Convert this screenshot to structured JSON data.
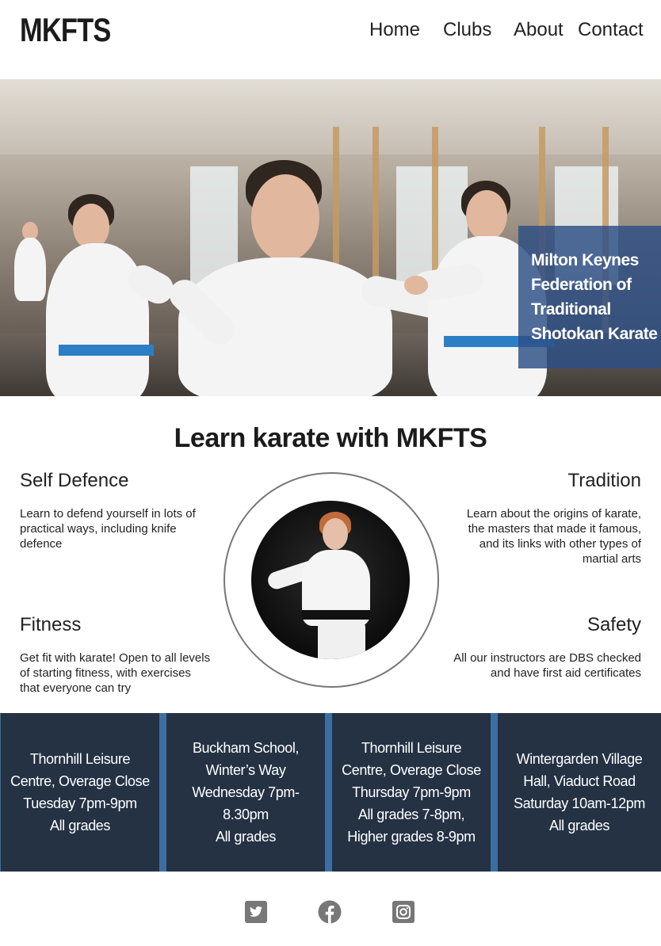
{
  "header": {
    "logo": "MKFTS",
    "nav": [
      {
        "label": "Home"
      },
      {
        "label": "Clubs"
      },
      {
        "label": "About"
      },
      {
        "label": "Contact"
      }
    ]
  },
  "hero": {
    "title": "Milton Keynes Federation of Traditional Shotokan Karate",
    "overlay_color": "#2c4e85"
  },
  "intro": {
    "title": "Learn karate with MKFTS",
    "features": [
      {
        "title": "Self Defence",
        "text": "Learn to defend yourself in lots of practical ways, including knife defence"
      },
      {
        "title": "Tradition",
        "text": "Learn about the origins of karate, the masters that made it famous, and its links with other types of martial arts"
      },
      {
        "title": "Fitness",
        "text": "Get fit with karate! Open to all levels of starting fitness, with exercises that everyone can try"
      },
      {
        "title": "Safety",
        "text": "All our instructors are DBS checked and have first aid certificates"
      }
    ]
  },
  "clubs": [
    {
      "lines": [
        "Thornhill Leisure Centre, Overage Close",
        "Tuesday 7pm-9pm",
        "All grades"
      ]
    },
    {
      "lines": [
        "Buckham School, Winter’s Way",
        "Wednesday 7pm-8.30pm",
        "All grades"
      ]
    },
    {
      "lines": [
        "Thornhill Leisure Centre, Overage Close",
        "Thursday 7pm-9pm",
        "All grades 7-8pm, Higher grades 8-9pm"
      ]
    },
    {
      "lines": [
        "Wintergarden Village Hall, Viaduct Road",
        "Saturday 10am-12pm",
        "All grades"
      ]
    }
  ],
  "footer": {
    "icons": [
      "twitter-icon",
      "facebook-icon",
      "instagram-icon"
    ],
    "icon_color": "#777777"
  }
}
